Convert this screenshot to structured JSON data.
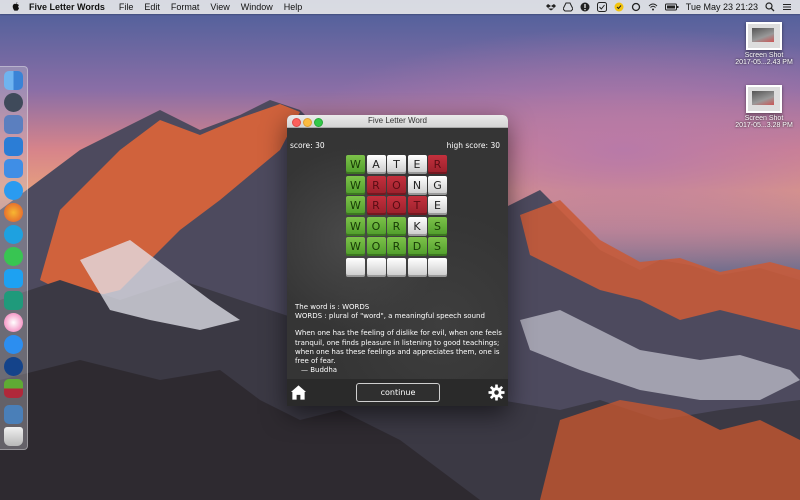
{
  "menubar": {
    "app_name": "Five Letter Words",
    "items": [
      "File",
      "Edit",
      "Format",
      "View",
      "Window",
      "Help"
    ],
    "clock": "Tue May 23  21:23"
  },
  "desktop": {
    "icons": [
      {
        "label1": "Screen Shot",
        "label2": "2017-05...2.43 PM"
      },
      {
        "label1": "Screen Shot",
        "label2": "2017-05...3.28 PM"
      }
    ]
  },
  "window": {
    "title": "Five Letter Word",
    "score_label": "score: 30",
    "high_score_label": "high score: 30",
    "grid": [
      [
        {
          "l": "W",
          "c": "green"
        },
        {
          "l": "A",
          "c": "white"
        },
        {
          "l": "T",
          "c": "white"
        },
        {
          "l": "E",
          "c": "white"
        },
        {
          "l": "R",
          "c": "red"
        }
      ],
      [
        {
          "l": "W",
          "c": "green"
        },
        {
          "l": "R",
          "c": "red"
        },
        {
          "l": "O",
          "c": "red"
        },
        {
          "l": "N",
          "c": "white"
        },
        {
          "l": "G",
          "c": "white"
        }
      ],
      [
        {
          "l": "W",
          "c": "green"
        },
        {
          "l": "R",
          "c": "red"
        },
        {
          "l": "O",
          "c": "red"
        },
        {
          "l": "T",
          "c": "red"
        },
        {
          "l": "E",
          "c": "white"
        }
      ],
      [
        {
          "l": "W",
          "c": "green"
        },
        {
          "l": "O",
          "c": "green"
        },
        {
          "l": "R",
          "c": "green"
        },
        {
          "l": "K",
          "c": "white"
        },
        {
          "l": "S",
          "c": "green"
        }
      ],
      [
        {
          "l": "W",
          "c": "green"
        },
        {
          "l": "O",
          "c": "green"
        },
        {
          "l": "R",
          "c": "green"
        },
        {
          "l": "D",
          "c": "green"
        },
        {
          "l": "S",
          "c": "green"
        }
      ],
      [
        {
          "l": "",
          "c": "white"
        },
        {
          "l": "",
          "c": "white"
        },
        {
          "l": "",
          "c": "white"
        },
        {
          "l": "",
          "c": "white"
        },
        {
          "l": "",
          "c": "white"
        }
      ]
    ],
    "word_line": "The word is : WORDS",
    "definition": "WORDS : plural of \"word\", a meaningful speech sound",
    "quote": "When one has the feeling of dislike for evil, when one feels tranquil, one finds pleasure in listening to good teachings; when one has these feelings and appreciates them, one is free of fear.",
    "author": "—  Buddha",
    "continue_label": "continue"
  },
  "colors": {
    "tile_green": "#5faa34",
    "tile_red": "#b0283a",
    "tile_white": "#e8e8e8"
  }
}
